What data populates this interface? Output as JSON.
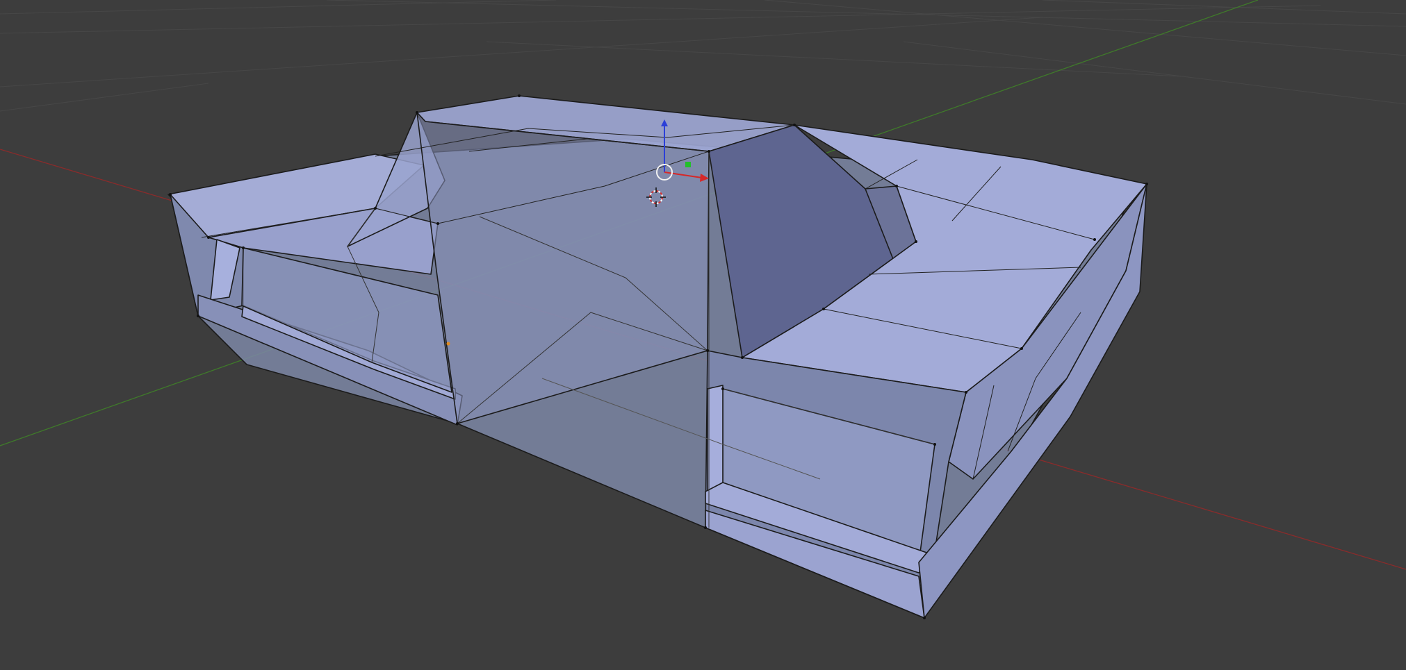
{
  "app": {
    "name": ""
  },
  "viewport": {
    "mode": "edit-mode-wireframe-xray",
    "colors": {
      "background": "#3d3d3d",
      "grid": "#4a4a4a",
      "x_axis": "#8a2b2b",
      "y_axis": "#3f7a2a",
      "face_light": "#a4acd6",
      "face_mid": "#8d96c4",
      "face_dark": "#5e6590",
      "edge": "#1b1b1b",
      "gizmo_z": "#2b3fd8",
      "gizmo_y": "#22c02a",
      "gizmo_x": "#d62828"
    },
    "objects": [
      {
        "name": "mesh-car-body",
        "icon": "mesh-icon"
      },
      {
        "name": "transform-gizmo",
        "icon": "translate-manipulator-icon"
      },
      {
        "name": "3d-cursor",
        "icon": "crosshair-icon"
      }
    ]
  }
}
